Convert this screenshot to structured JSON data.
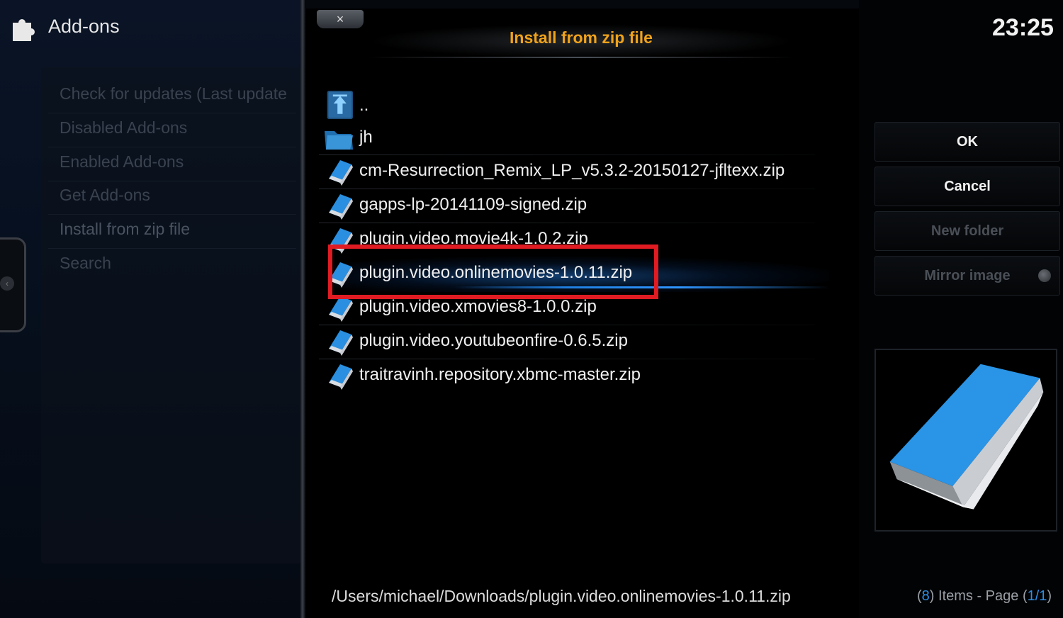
{
  "header": {
    "section_title": "Add-ons",
    "clock": "23:25"
  },
  "left_menu": {
    "items": [
      {
        "label": "Check for updates (Last update"
      },
      {
        "label": "Disabled Add-ons"
      },
      {
        "label": "Enabled Add-ons"
      },
      {
        "label": "Get Add-ons"
      },
      {
        "label": "Install from zip file"
      },
      {
        "label": "Search"
      }
    ]
  },
  "dialog": {
    "close_label": "×",
    "title": "Install from zip file",
    "files": [
      {
        "name": "..",
        "icon": "parent-folder-icon"
      },
      {
        "name": "jh",
        "icon": "folder-icon"
      },
      {
        "name": "cm-Resurrection_Remix_LP_v5.3.2-20150127-jfltexx.zip",
        "icon": "zip-file-icon"
      },
      {
        "name": "gapps-lp-20141109-signed.zip",
        "icon": "zip-file-icon"
      },
      {
        "name": "plugin.video.movie4k-1.0.2.zip",
        "icon": "zip-file-icon"
      },
      {
        "name": "plugin.video.onlinemovies-1.0.11.zip",
        "icon": "zip-file-icon"
      },
      {
        "name": "plugin.video.xmovies8-1.0.0.zip",
        "icon": "zip-file-icon"
      },
      {
        "name": "plugin.video.youtubeonfire-0.6.5.zip",
        "icon": "zip-file-icon"
      },
      {
        "name": "traitravinh.repository.xbmc-master.zip",
        "icon": "zip-file-icon"
      }
    ],
    "selected_path": "/Users/michael/Downloads/plugin.video.onlinemovies-1.0.11.zip"
  },
  "buttons": {
    "ok": "OK",
    "cancel": "Cancel",
    "new_folder": "New folder",
    "mirror_image": "Mirror image"
  },
  "status": {
    "items_count": "8",
    "items_label": ") Items - Page (",
    "page": "1/1",
    "open_paren": "(",
    "close_paren": ")"
  },
  "colors": {
    "title_accent": "#f0a21b",
    "highlight_box": "#e01b22",
    "focus_blue": "#2f95ff",
    "count_blue": "#2e8fe8"
  }
}
